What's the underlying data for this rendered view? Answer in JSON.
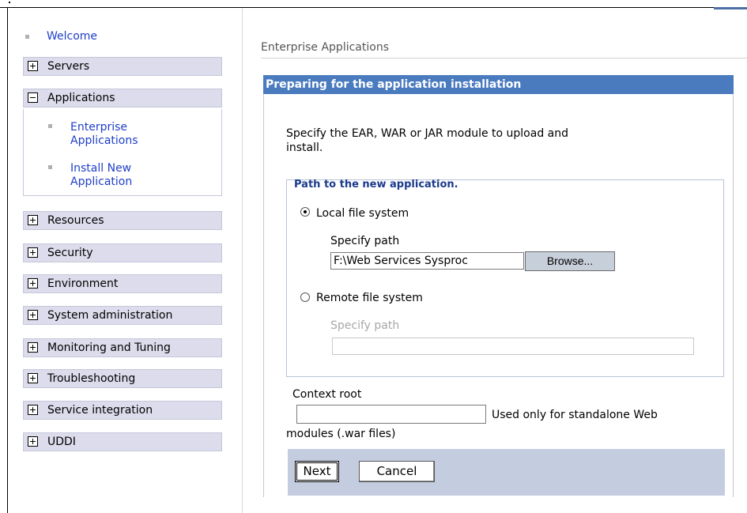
{
  "sidebar": {
    "welcome": "Welcome",
    "categories": [
      {
        "label": "Servers",
        "state": "collapsed"
      },
      {
        "label": "Applications",
        "state": "expanded"
      },
      {
        "label": "Resources",
        "state": "collapsed"
      },
      {
        "label": "Security",
        "state": "collapsed"
      },
      {
        "label": "Environment",
        "state": "collapsed"
      },
      {
        "label": "System administration",
        "state": "collapsed"
      },
      {
        "label": "Monitoring and Tuning",
        "state": "collapsed"
      },
      {
        "label": "Troubleshooting",
        "state": "collapsed"
      },
      {
        "label": "Service integration",
        "state": "collapsed"
      },
      {
        "label": "UDDI",
        "state": "collapsed"
      }
    ],
    "applications_items": [
      {
        "line1": "Enterprise",
        "line2": "Applications"
      },
      {
        "line1": "Install New",
        "line2": "Application"
      }
    ]
  },
  "main": {
    "breadcrumb": "Enterprise Applications",
    "panel_title": "Preparing for the application installation",
    "intro_line1": "Specify the EAR, WAR or JAR module to upload and",
    "intro_line2": "install.",
    "fieldset_legend": "Path to the new application.",
    "local_option": "Local file system",
    "local_specify_label": "Specify path",
    "local_path_value": "F:\\Web Services Sysproc",
    "browse_label": "Browse...",
    "remote_option": "Remote file system",
    "remote_specify_label": "Specify path",
    "remote_path_value": "",
    "context_root_label": "Context root",
    "context_root_value": "",
    "context_note_line1": "Used only for standalone Web",
    "context_note_line2": "modules (.war files)",
    "selected_option": "local"
  },
  "actions": {
    "next_label": "Next",
    "cancel_label": "Cancel"
  },
  "colors": {
    "panel_header": "#4a7bbf",
    "nav_category_bg": "#dcdcec",
    "link": "#1f3fc7",
    "action_bar": "#c4cde0"
  }
}
